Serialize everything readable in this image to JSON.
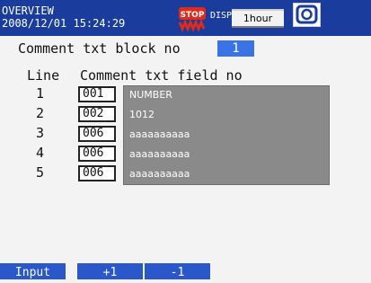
{
  "header": {
    "title_line1": "OVERVIEW",
    "date": "2008/12/01",
    "time": "15:24:29",
    "stop_icon_label": "STOP",
    "disp_label": "DISP",
    "interval": "1hour",
    "status_icon": "display-status-icon"
  },
  "block": {
    "label": "Comment txt block no",
    "value": "1"
  },
  "columns": {
    "line": "Line",
    "field": "Comment txt field no"
  },
  "rows": [
    {
      "line": "1",
      "field": "001",
      "text": "NUMBER"
    },
    {
      "line": "2",
      "field": "002",
      "text": "1012"
    },
    {
      "line": "3",
      "field": "006",
      "text": "aaaaaaaaaa"
    },
    {
      "line": "4",
      "field": "006",
      "text": "aaaaaaaaaa"
    },
    {
      "line": "5",
      "field": "006",
      "text": "aaaaaaaaaa"
    }
  ],
  "softkeys": [
    "Input",
    "+1",
    "-1"
  ],
  "colors": {
    "header_bg": "#1a3c9c",
    "softkey_bg": "#2a57c9",
    "selection": "#3a73e6",
    "stop_red": "#e02a1a"
  }
}
